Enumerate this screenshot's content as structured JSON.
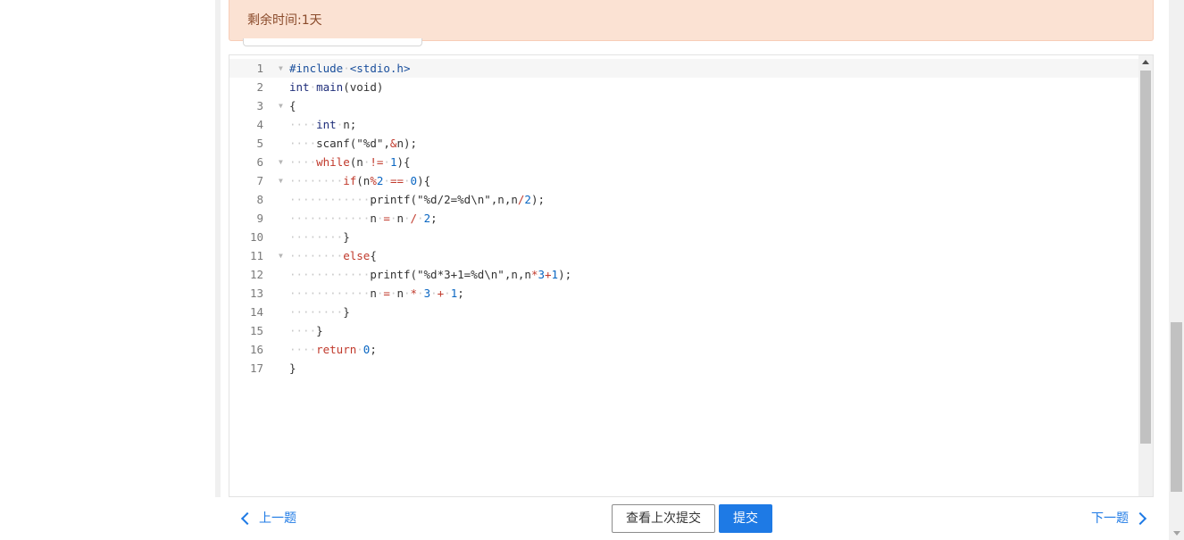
{
  "timer": {
    "text": "剩余时间:1天"
  },
  "editor": {
    "lines": [
      {
        "n": "1",
        "fold": true,
        "tokens": [
          [
            "pre",
            "#include"
          ],
          [
            "ws",
            "·"
          ],
          [
            "pre",
            "<stdio.h>"
          ]
        ]
      },
      {
        "n": "2",
        "fold": false,
        "tokens": [
          [
            "type",
            "int"
          ],
          [
            "ws",
            "·"
          ],
          [
            "fn",
            "main"
          ],
          [
            "plain",
            "(void)"
          ]
        ]
      },
      {
        "n": "3",
        "fold": true,
        "tokens": [
          [
            "plain",
            "{"
          ]
        ]
      },
      {
        "n": "4",
        "fold": false,
        "tokens": [
          [
            "ws",
            "····"
          ],
          [
            "type",
            "int"
          ],
          [
            "ws",
            "·"
          ],
          [
            "plain",
            "n;"
          ]
        ]
      },
      {
        "n": "5",
        "fold": false,
        "tokens": [
          [
            "ws",
            "····"
          ],
          [
            "plain",
            "scanf(\"%d\","
          ],
          [
            "op",
            "&"
          ],
          [
            "plain",
            "n);"
          ]
        ]
      },
      {
        "n": "6",
        "fold": true,
        "tokens": [
          [
            "ws",
            "····"
          ],
          [
            "kw",
            "while"
          ],
          [
            "plain",
            "(n"
          ],
          [
            "ws",
            "·"
          ],
          [
            "op",
            "!="
          ],
          [
            "ws",
            "·"
          ],
          [
            "num",
            "1"
          ],
          [
            "plain",
            "){"
          ]
        ]
      },
      {
        "n": "7",
        "fold": true,
        "tokens": [
          [
            "ws",
            "········"
          ],
          [
            "kw",
            "if"
          ],
          [
            "plain",
            "(n"
          ],
          [
            "op",
            "%"
          ],
          [
            "num",
            "2"
          ],
          [
            "ws",
            "·"
          ],
          [
            "op",
            "=="
          ],
          [
            "ws",
            "·"
          ],
          [
            "num",
            "0"
          ],
          [
            "plain",
            "){"
          ]
        ]
      },
      {
        "n": "8",
        "fold": false,
        "tokens": [
          [
            "ws",
            "············"
          ],
          [
            "plain",
            "printf(\"%d/2=%d\\n\",n,n"
          ],
          [
            "op",
            "/"
          ],
          [
            "num",
            "2"
          ],
          [
            "plain",
            ");"
          ]
        ]
      },
      {
        "n": "9",
        "fold": false,
        "tokens": [
          [
            "ws",
            "············"
          ],
          [
            "plain",
            "n"
          ],
          [
            "ws",
            "·"
          ],
          [
            "op",
            "="
          ],
          [
            "ws",
            "·"
          ],
          [
            "plain",
            "n"
          ],
          [
            "ws",
            "·"
          ],
          [
            "op",
            "/"
          ],
          [
            "ws",
            "·"
          ],
          [
            "num",
            "2"
          ],
          [
            "plain",
            ";"
          ]
        ]
      },
      {
        "n": "10",
        "fold": false,
        "tokens": [
          [
            "ws",
            "········"
          ],
          [
            "plain",
            "}"
          ]
        ]
      },
      {
        "n": "11",
        "fold": true,
        "tokens": [
          [
            "ws",
            "········"
          ],
          [
            "kw",
            "else"
          ],
          [
            "plain",
            "{"
          ]
        ]
      },
      {
        "n": "12",
        "fold": false,
        "tokens": [
          [
            "ws",
            "············"
          ],
          [
            "plain",
            "printf(\"%d*3+1=%d\\n\",n,n"
          ],
          [
            "op",
            "*"
          ],
          [
            "num",
            "3"
          ],
          [
            "op",
            "+"
          ],
          [
            "num",
            "1"
          ],
          [
            "plain",
            ");"
          ]
        ]
      },
      {
        "n": "13",
        "fold": false,
        "tokens": [
          [
            "ws",
            "············"
          ],
          [
            "plain",
            "n"
          ],
          [
            "ws",
            "·"
          ],
          [
            "op",
            "="
          ],
          [
            "ws",
            "·"
          ],
          [
            "plain",
            "n"
          ],
          [
            "ws",
            "·"
          ],
          [
            "op",
            "*"
          ],
          [
            "ws",
            "·"
          ],
          [
            "num",
            "3"
          ],
          [
            "ws",
            "·"
          ],
          [
            "op",
            "+"
          ],
          [
            "ws",
            "·"
          ],
          [
            "num",
            "1"
          ],
          [
            "plain",
            ";"
          ]
        ]
      },
      {
        "n": "14",
        "fold": false,
        "tokens": [
          [
            "ws",
            "········"
          ],
          [
            "plain",
            "}"
          ]
        ]
      },
      {
        "n": "15",
        "fold": false,
        "tokens": [
          [
            "ws",
            "····"
          ],
          [
            "plain",
            "}"
          ]
        ]
      },
      {
        "n": "16",
        "fold": false,
        "tokens": [
          [
            "ws",
            "····"
          ],
          [
            "kw",
            "return"
          ],
          [
            "ws",
            "·"
          ],
          [
            "num",
            "0"
          ],
          [
            "plain",
            ";"
          ]
        ]
      },
      {
        "n": "17",
        "fold": false,
        "tokens": [
          [
            "plain",
            "}"
          ]
        ]
      }
    ]
  },
  "footer": {
    "prev_label": "上一题",
    "next_label": "下一题",
    "view_last_label": "查看上次提交",
    "submit_label": "提交"
  },
  "icons": {
    "prev": "chevron-left-icon",
    "next": "chevron-right-icon",
    "fold": "fold-arrow-icon"
  },
  "colors": {
    "accent": "#1e7ae5",
    "banner_bg": "#fbe2d3",
    "banner_text": "#8a4a2a"
  }
}
